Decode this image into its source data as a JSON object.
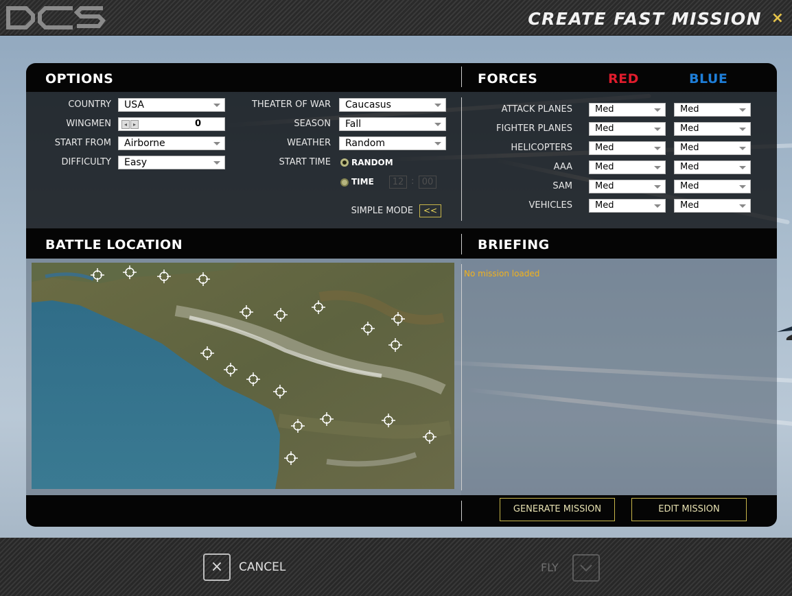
{
  "window": {
    "title": "CREATE FAST MISSION",
    "close_glyph": "×",
    "logo_text": "DCS"
  },
  "options": {
    "heading": "OPTIONS",
    "country": {
      "label": "COUNTRY",
      "value": "USA"
    },
    "wingmen": {
      "label": "WINGMEN",
      "value": "0",
      "left_glyph": "◂",
      "right_glyph": "▸"
    },
    "start_from": {
      "label": "START FROM",
      "value": "Airborne"
    },
    "difficulty": {
      "label": "DIFFICULTY",
      "value": "Easy"
    },
    "theater_of_war": {
      "label": "THEATER OF WAR",
      "value": "Caucasus"
    },
    "season": {
      "label": "SEASON",
      "value": "Fall"
    },
    "weather": {
      "label": "WEATHER",
      "value": "Random"
    },
    "start_time": {
      "label": "START TIME",
      "random_label": "RANDOM",
      "time_label": "TIME",
      "hours": "12",
      "minutes": "00",
      "separator": ":"
    },
    "simple_mode": {
      "label": "SIMPLE MODE",
      "button": "<<"
    }
  },
  "forces": {
    "heading": "FORCES",
    "red_label": "RED",
    "blue_label": "BLUE",
    "rows": [
      {
        "label": "ATTACK PLANES",
        "red": "Med",
        "blue": "Med"
      },
      {
        "label": "FIGHTER PLANES",
        "red": "Med",
        "blue": "Med"
      },
      {
        "label": "HELICOPTERS",
        "red": "Med",
        "blue": "Med"
      },
      {
        "label": "AAA",
        "red": "Med",
        "blue": "Med"
      },
      {
        "label": "SAM",
        "red": "Med",
        "blue": "Med"
      },
      {
        "label": "VEHICLES",
        "red": "Med",
        "blue": "Med"
      }
    ]
  },
  "battle_location": {
    "heading": "BATTLE LOCATION"
  },
  "briefing": {
    "heading": "BRIEFING",
    "status": "No mission loaded"
  },
  "actions": {
    "generate": "GENERATE MISSION",
    "edit": "EDIT MISSION"
  },
  "footer": {
    "cancel_glyph": "×",
    "cancel": "CANCEL",
    "fly": "FLY"
  },
  "colors": {
    "red_team": "#e01c2c",
    "blue_team": "#1e7ed8",
    "accent_gold": "#c9b74a",
    "briefing_text": "#f2b21c"
  },
  "icons": [
    "logo-icon",
    "close-icon",
    "dropdown-arrow-icon",
    "crosshair-target-icon",
    "cancel-x-icon",
    "fly-check-icon"
  ]
}
